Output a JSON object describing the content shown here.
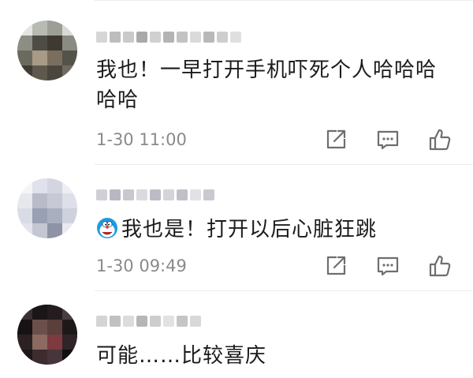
{
  "comments": [
    {
      "username": "▓▓▓▓▓▓▓",
      "content": "我也！一早打开手机吓死个人哈哈哈哈哈",
      "time": "1-30 11:00"
    },
    {
      "username": "▓▓▓▓▓▓",
      "emoji": "doraemon-emoji",
      "content": "我也是！打开以后心脏狂跳",
      "time": "1-30 09:49"
    },
    {
      "username": "▓▓▓▓▓",
      "content": "可能……比较喜庆"
    }
  ],
  "icons": {
    "share": "share-icon",
    "reply": "comment-reply-icon",
    "like": "thumbs-up-icon"
  },
  "colors": {
    "text": "#1b1b1b",
    "meta": "#8a8a8a",
    "divider": "#ececec",
    "icon": "#6e6e6e"
  }
}
